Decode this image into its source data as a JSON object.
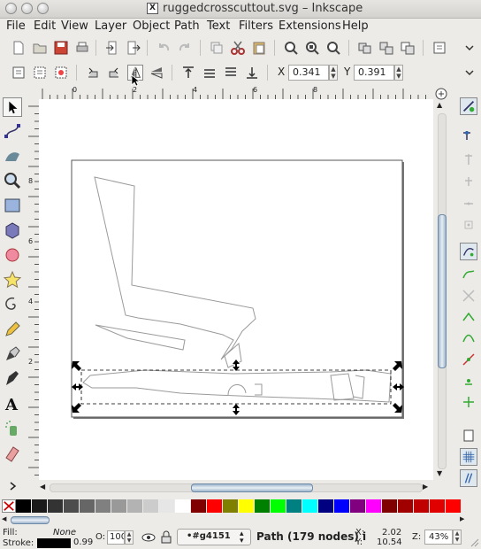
{
  "window": {
    "title": "ruggedcrosscuttout.svg – Inkscape",
    "title_icon_letter": "X"
  },
  "menu": [
    "File",
    "Edit",
    "View",
    "Layer",
    "Object",
    "Path",
    "Text",
    "Filters",
    "Extensions",
    "Help"
  ],
  "tool_controls": {
    "x_label": "X",
    "x_value": "0.341",
    "y_label": "Y",
    "y_value": "0.391"
  },
  "ruler": {
    "h_ticks": [
      "0",
      "2",
      "4",
      "6",
      "8"
    ],
    "v_ticks": [
      "8",
      "6",
      "4",
      "2"
    ]
  },
  "palette": [
    "#000000",
    "#1a1a1a",
    "#333333",
    "#4d4d4d",
    "#666666",
    "#808080",
    "#999999",
    "#b3b3b3",
    "#cccccc",
    "#e6e6e6",
    "#ffffff",
    "#800000",
    "#ff0000",
    "#808000",
    "#ffff00",
    "#008000",
    "#00ff00",
    "#008080",
    "#00ffff",
    "#000080",
    "#0000ff",
    "#800080",
    "#ff00ff",
    "#800000",
    "#a00000",
    "#c00000",
    "#e00000",
    "#ff0000"
  ],
  "status": {
    "fill_label": "Fill:",
    "fill_value": "None",
    "stroke_label": "Stroke:",
    "stroke_width": "0.99",
    "opacity_label": "O:",
    "opacity_value": "100",
    "layer_value": "•#g4151",
    "message": "Path (179 nodes) i",
    "cursor_x_label": "X:",
    "cursor_x": "2.02",
    "cursor_y_label": "Y:",
    "cursor_y": "10.54",
    "zoom_label": "Z:",
    "zoom_value": "43%"
  }
}
